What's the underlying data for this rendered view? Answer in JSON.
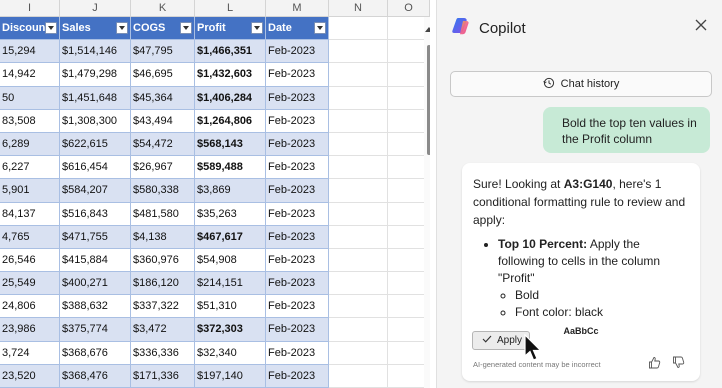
{
  "sheet": {
    "columns": [
      {
        "letter": "I",
        "header": "Discounts"
      },
      {
        "letter": "J",
        "header": "Sales"
      },
      {
        "letter": "K",
        "header": "COGS"
      },
      {
        "letter": "L",
        "header": "Profit"
      },
      {
        "letter": "M",
        "header": "Date"
      },
      {
        "letter": "N",
        "header": ""
      },
      {
        "letter": "O",
        "header": ""
      }
    ],
    "rows": [
      {
        "discounts": "15,294",
        "sales": "$1,514,146",
        "cogs": "$47,795",
        "profit": "$1,466,351",
        "date": "Feb-2023",
        "bold": true
      },
      {
        "discounts": "14,942",
        "sales": "$1,479,298",
        "cogs": "$46,695",
        "profit": "$1,432,603",
        "date": "Feb-2023",
        "bold": true
      },
      {
        "discounts": "50",
        "sales": "$1,451,648",
        "cogs": "$45,364",
        "profit": "$1,406,284",
        "date": "Feb-2023",
        "bold": true
      },
      {
        "discounts": "83,508",
        "sales": "$1,308,300",
        "cogs": "$43,494",
        "profit": "$1,264,806",
        "date": "Feb-2023",
        "bold": true
      },
      {
        "discounts": "6,289",
        "sales": "$622,615",
        "cogs": "$54,472",
        "profit": "$568,143",
        "date": "Feb-2023",
        "bold": true
      },
      {
        "discounts": "6,227",
        "sales": "$616,454",
        "cogs": "$26,967",
        "profit": "$589,488",
        "date": "Feb-2023",
        "bold": true
      },
      {
        "discounts": "5,901",
        "sales": "$584,207",
        "cogs": "$580,338",
        "profit": "$3,869",
        "date": "Feb-2023",
        "bold": false
      },
      {
        "discounts": "84,137",
        "sales": "$516,843",
        "cogs": "$481,580",
        "profit": "$35,263",
        "date": "Feb-2023",
        "bold": false
      },
      {
        "discounts": "4,765",
        "sales": "$471,755",
        "cogs": "$4,138",
        "profit": "$467,617",
        "date": "Feb-2023",
        "bold": true
      },
      {
        "discounts": "26,546",
        "sales": "$415,884",
        "cogs": "$360,976",
        "profit": "$54,908",
        "date": "Feb-2023",
        "bold": false
      },
      {
        "discounts": "25,549",
        "sales": "$400,271",
        "cogs": "$186,120",
        "profit": "$214,151",
        "date": "Feb-2023",
        "bold": false
      },
      {
        "discounts": "24,806",
        "sales": "$388,632",
        "cogs": "$337,322",
        "profit": "$51,310",
        "date": "Feb-2023",
        "bold": false
      },
      {
        "discounts": "23,986",
        "sales": "$375,774",
        "cogs": "$3,472",
        "profit": "$372,303",
        "date": "Feb-2023",
        "bold": true
      },
      {
        "discounts": "3,724",
        "sales": "$368,676",
        "cogs": "$336,336",
        "profit": "$32,340",
        "date": "Feb-2023",
        "bold": false
      },
      {
        "discounts": "23,520",
        "sales": "$368,476",
        "cogs": "$171,336",
        "profit": "$197,140",
        "date": "Feb-2023",
        "bold": false
      }
    ]
  },
  "copilot": {
    "title": "Copilot",
    "history_label": "Chat history",
    "user_message": "Bold the top ten values in the Profit column",
    "reply": {
      "intro_pre": "Sure! Looking at ",
      "intro_range": "A3:G140",
      "intro_post": ", here's 1 conditional formatting rule to review and apply:",
      "rule_title": "Top 10 Percent:",
      "rule_text": " Apply the following to cells in the column \"Profit\"",
      "sub_items": [
        "Bold",
        "Font color: black"
      ],
      "sample": "AaBbCc",
      "apply_label": "Apply",
      "disclaimer": "AI-generated content may be incorrect"
    },
    "icons": [
      "copilot-logo-icon",
      "close-icon",
      "history-icon",
      "check-icon",
      "thumbs-up-icon",
      "thumbs-down-icon",
      "mouse-cursor-icon"
    ],
    "colors": {
      "table_header": "#4472c4",
      "band": "#d9e1f2",
      "user_bubble": "#c7ead6",
      "pane_bg": "#f4f4f4"
    }
  }
}
